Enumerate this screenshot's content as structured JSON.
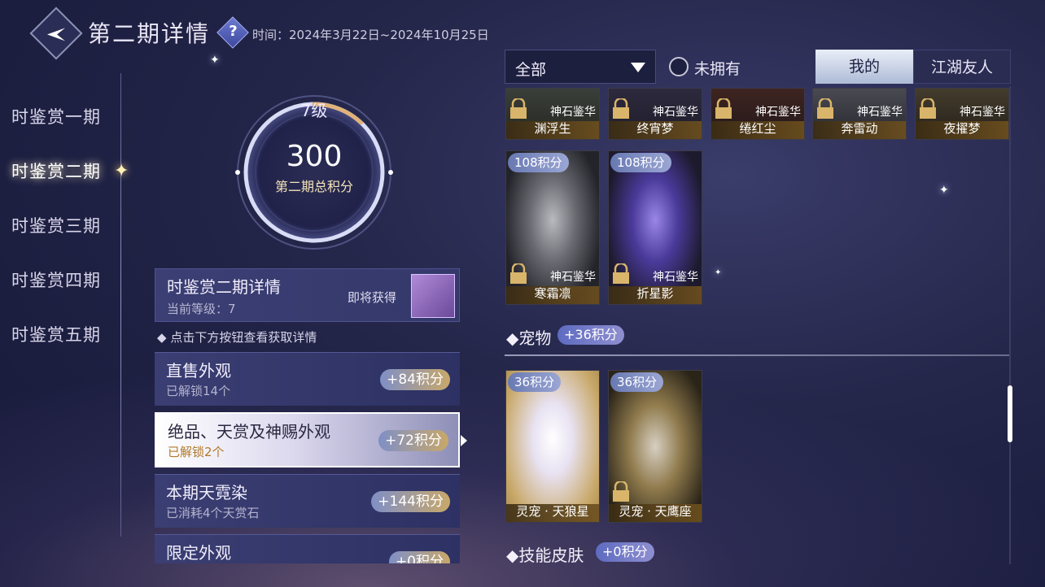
{
  "header": {
    "title": "第二期详情",
    "time_label": "时间：2024年3月22日~2024年10月25日"
  },
  "seasons": [
    {
      "label": "时鉴赏一期"
    },
    {
      "label": "时鉴赏二期"
    },
    {
      "label": "时鉴赏三期"
    },
    {
      "label": "时鉴赏四期"
    },
    {
      "label": "时鉴赏五期"
    }
  ],
  "score": {
    "level": "7级",
    "points": "300",
    "label": "第二期总积分",
    "ring_progress": 0.12
  },
  "detail": {
    "title": "时鉴赏二期详情",
    "current_level": "当前等级：7",
    "soon_label": "即将获得"
  },
  "hint": "点击下方按钮查看获取详情",
  "categories": [
    {
      "title": "直售外观",
      "sub": "已解锁14个",
      "points": "+84积分"
    },
    {
      "title": "绝品、天赏及神赐外观",
      "sub": "已解锁2个",
      "points": "+72积分"
    },
    {
      "title": "本期天霓染",
      "sub": "已消耗4个天赏石",
      "points": "+144积分"
    },
    {
      "title": "限定外观",
      "sub": "",
      "points": "+0积分"
    }
  ],
  "filter": {
    "selected": "全部",
    "unowned_label": "未拥有"
  },
  "tabs": {
    "mine": "我的",
    "friends": "江湖友人"
  },
  "top_row": [
    {
      "tag": "神石鉴华",
      "name": "渊浮生"
    },
    {
      "tag": "神石鉴华",
      "name": "终宵梦"
    },
    {
      "tag": "神石鉴华",
      "name": "绻红尘"
    },
    {
      "tag": "神石鉴华",
      "name": "奔雷动"
    },
    {
      "tag": "神石鉴华",
      "name": "夜擢梦"
    }
  ],
  "mount_row": [
    {
      "points": "108积分",
      "tag": "神石鉴华",
      "name": "寒霜凛"
    },
    {
      "points": "108积分",
      "tag": "神石鉴华",
      "name": "折星影"
    }
  ],
  "pet_section": {
    "title": "宠物",
    "points": "+36积分",
    "items": [
      {
        "points": "36积分",
        "name": "灵宠 · 天狼星"
      },
      {
        "points": "36积分",
        "name": "灵宠 · 天鹰座"
      }
    ]
  },
  "skill_section": {
    "title": "技能皮肤",
    "points": "+0积分"
  },
  "colors": {
    "background": "#24264a",
    "gold_accent": "#c8a86a",
    "badge_blue": "#6879b2"
  }
}
